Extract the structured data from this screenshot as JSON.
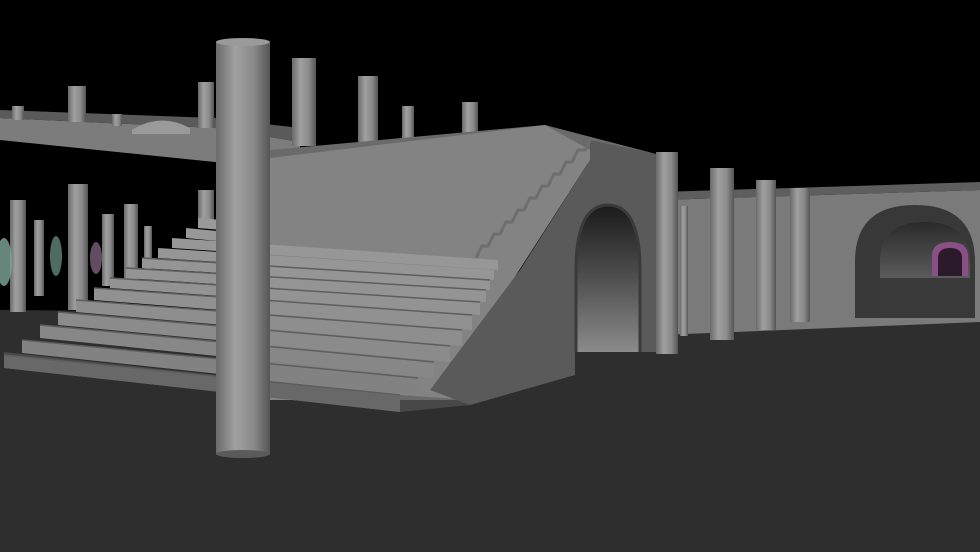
{
  "scene": {
    "kind": "3d-render-viewport",
    "description_visible_text": "",
    "palette": {
      "sky": "#000000",
      "floor": "#2e2e2e",
      "floor_far": "#353535",
      "stone_light": "#8c8c8c",
      "stone_mid": "#7a7a7a",
      "stone_dark": "#555555",
      "stone_shadow": "#444444",
      "arch_inner_dark": "#1e1e1e",
      "arch_inner_light": "#9a9a9a",
      "column": "#8a8a8a",
      "column_shade": "#5c5c5c",
      "accent_green": "#7fa89a",
      "accent_purple": "#8a4f86"
    }
  }
}
